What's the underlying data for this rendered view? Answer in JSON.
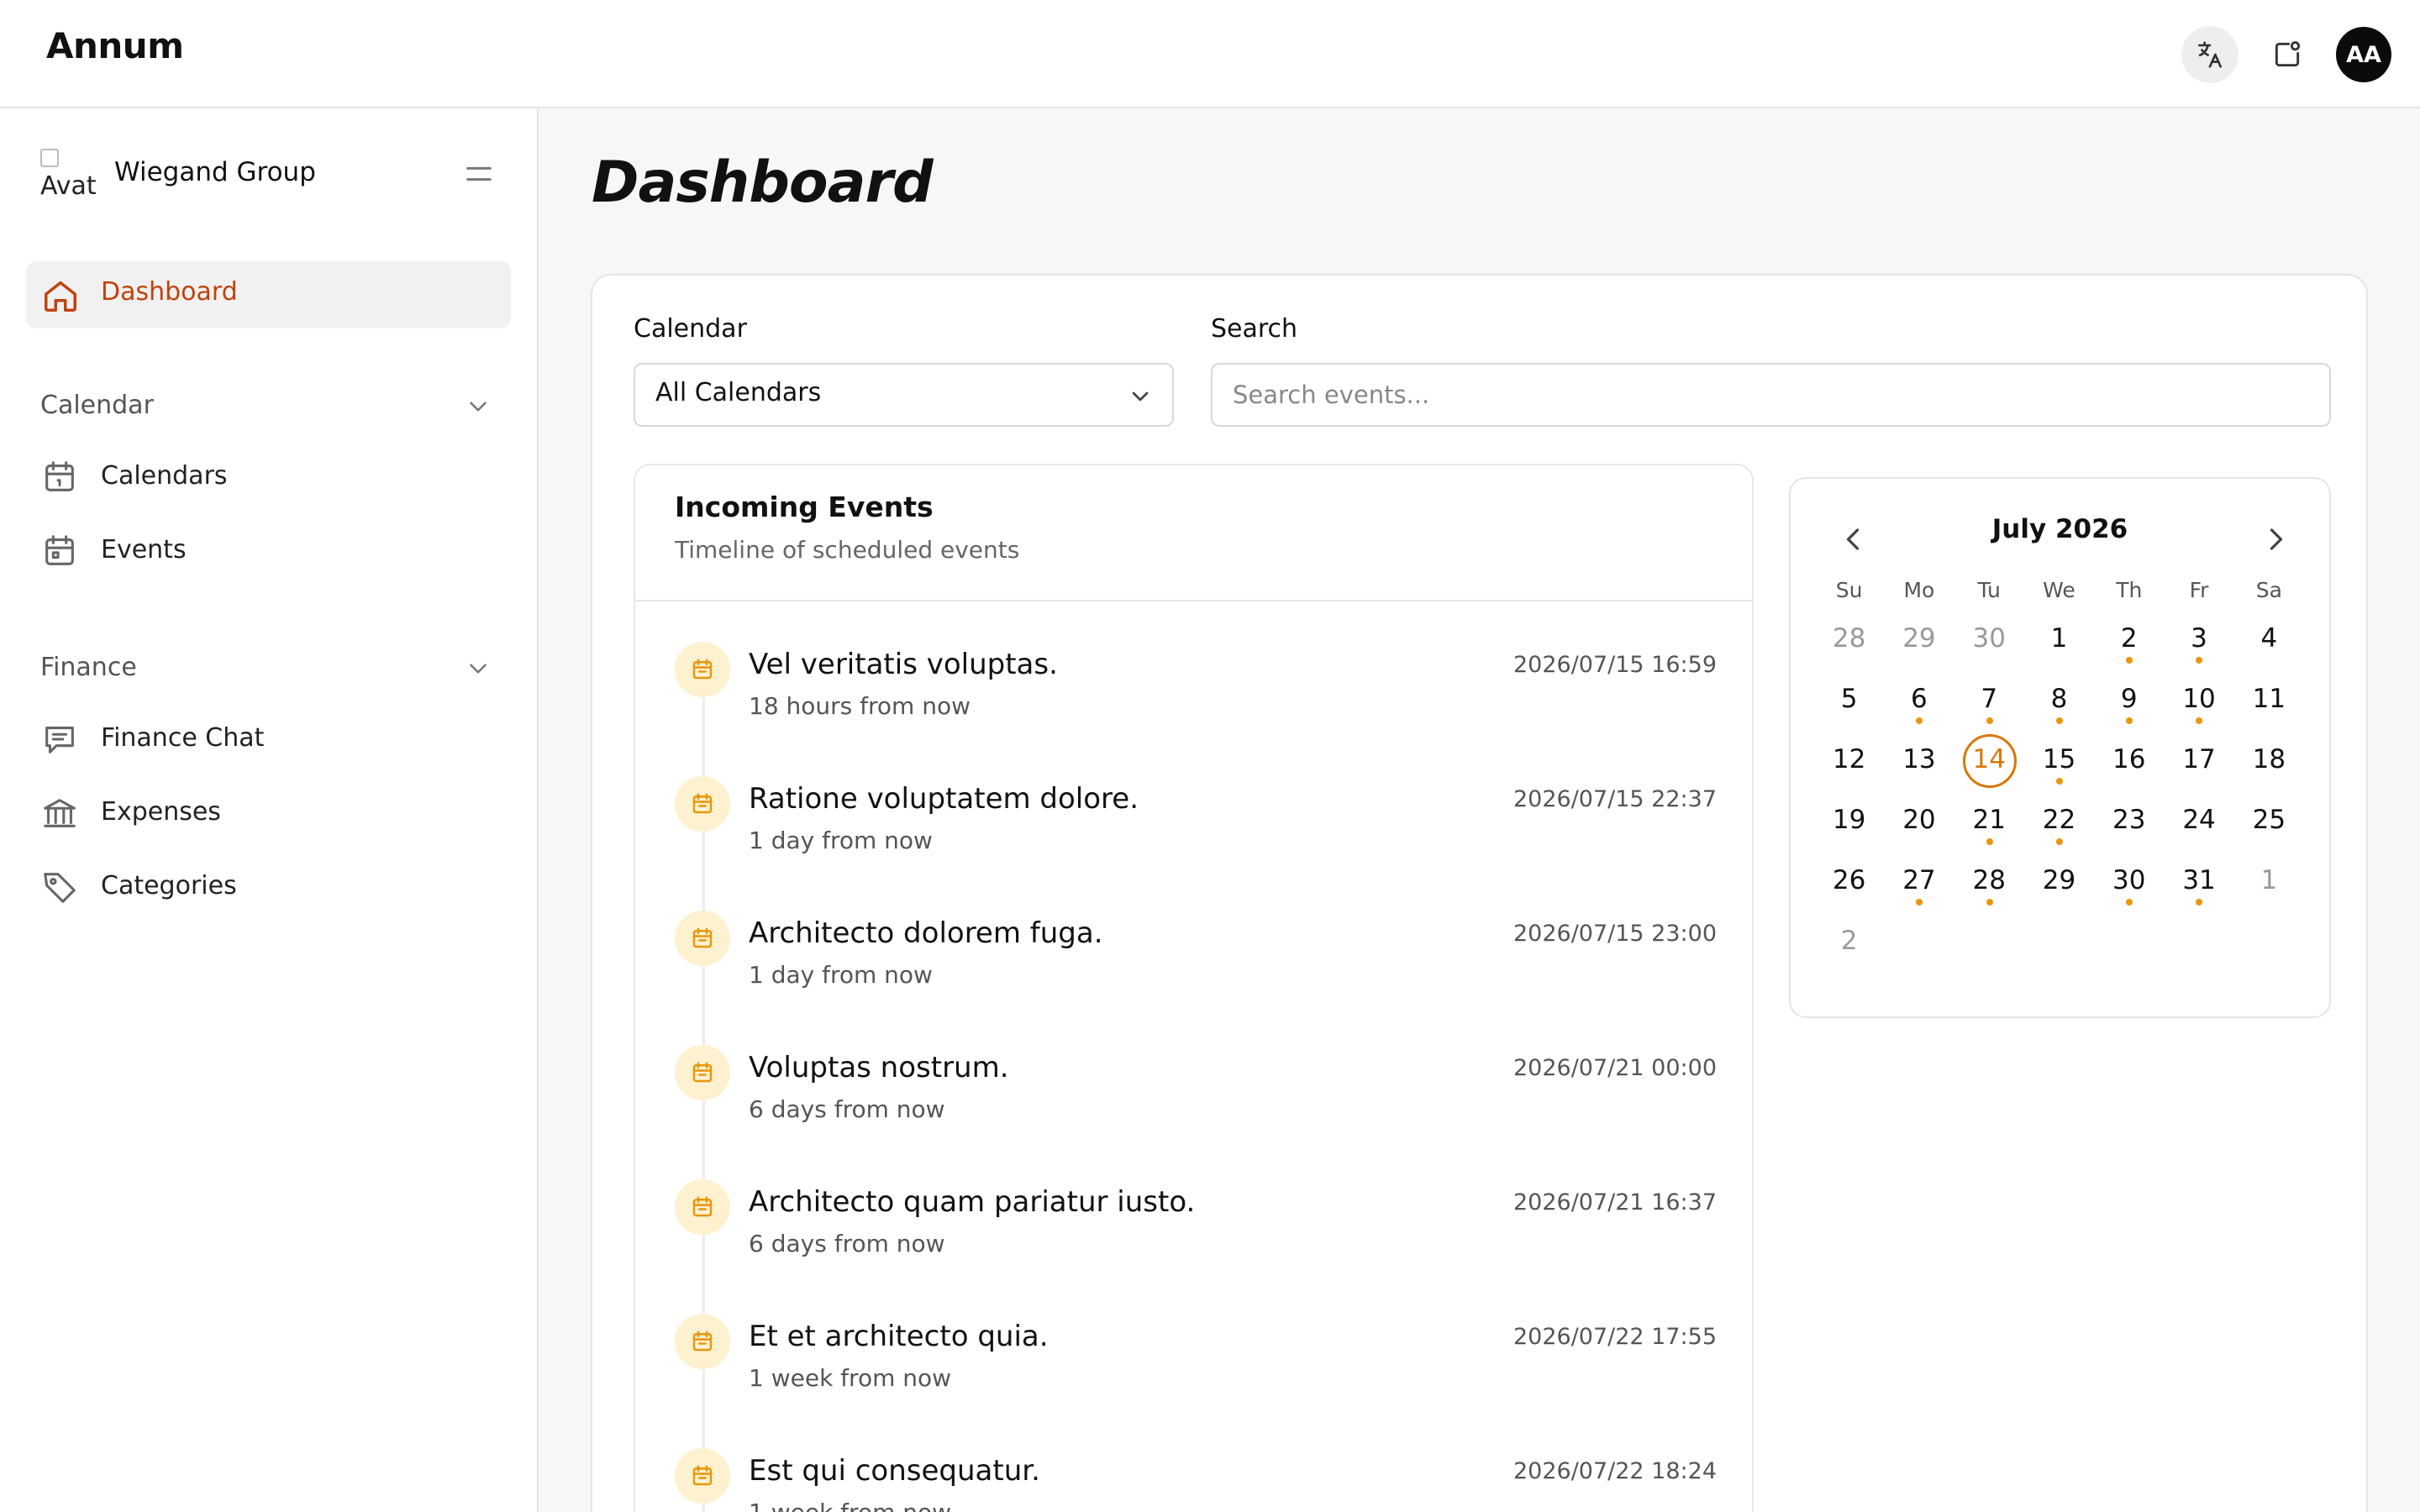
{
  "app": {
    "brand": "Annum"
  },
  "topbar": {
    "avatar_initials": "AA",
    "icons": [
      "translate-icon",
      "notification-icon"
    ]
  },
  "sidebar": {
    "org": {
      "name": "Wiegand Group",
      "avatar_alt": "Avat"
    },
    "active_item": {
      "label": "Dashboard",
      "icon": "home-icon",
      "color": "#c2410c"
    },
    "sections": [
      {
        "label": "Calendar",
        "items": [
          {
            "label": "Calendars",
            "icon": "calendar-icon"
          },
          {
            "label": "Events",
            "icon": "calendar-icon"
          }
        ]
      },
      {
        "label": "Finance",
        "items": [
          {
            "label": "Finance Chat",
            "icon": "chat-icon"
          },
          {
            "label": "Expenses",
            "icon": "bank-icon"
          },
          {
            "label": "Categories",
            "icon": "tag-icon"
          }
        ]
      }
    ]
  },
  "main": {
    "title": "Dashboard",
    "filters": {
      "calendar_label": "Calendar",
      "calendar_value": "All Calendars",
      "search_label": "Search",
      "search_placeholder": "Search events..."
    },
    "events": {
      "title": "Incoming Events",
      "subtitle": "Timeline of scheduled events",
      "items": [
        {
          "title": "Vel veritatis voluptas.",
          "relative": "18 hours from now",
          "date": "2026/07/15 16:59"
        },
        {
          "title": "Ratione voluptatem dolore.",
          "relative": "1 day from now",
          "date": "2026/07/15 22:37"
        },
        {
          "title": "Architecto dolorem fuga.",
          "relative": "1 day from now",
          "date": "2026/07/15 23:00"
        },
        {
          "title": "Voluptas nostrum.",
          "relative": "6 days from now",
          "date": "2026/07/21 00:00"
        },
        {
          "title": "Architecto quam pariatur iusto.",
          "relative": "6 days from now",
          "date": "2026/07/21 16:37"
        },
        {
          "title": "Et et architecto quia.",
          "relative": "1 week from now",
          "date": "2026/07/22 17:55"
        },
        {
          "title": "Est qui consequatur.",
          "relative": "1 week from now",
          "date": "2026/07/22 18:24"
        }
      ]
    },
    "mini_calendar": {
      "month": "July 2026",
      "weekdays": [
        "Su",
        "Mo",
        "Tu",
        "We",
        "Th",
        "Fr",
        "Sa"
      ],
      "today": 14,
      "accent": "#d97706",
      "weeks": [
        [
          {
            "d": "28",
            "m": true
          },
          {
            "d": "29",
            "m": true
          },
          {
            "d": "30",
            "m": true
          },
          {
            "d": "1"
          },
          {
            "d": "2",
            "e": true
          },
          {
            "d": "3",
            "e": true
          },
          {
            "d": "4"
          }
        ],
        [
          {
            "d": "5"
          },
          {
            "d": "6",
            "e": true
          },
          {
            "d": "7",
            "e": true
          },
          {
            "d": "8",
            "e": true
          },
          {
            "d": "9",
            "e": true
          },
          {
            "d": "10",
            "e": true
          },
          {
            "d": "11"
          }
        ],
        [
          {
            "d": "12"
          },
          {
            "d": "13"
          },
          {
            "d": "14",
            "t": true
          },
          {
            "d": "15",
            "e": true
          },
          {
            "d": "16"
          },
          {
            "d": "17"
          },
          {
            "d": "18"
          }
        ],
        [
          {
            "d": "19"
          },
          {
            "d": "20"
          },
          {
            "d": "21",
            "e": true
          },
          {
            "d": "22",
            "e": true
          },
          {
            "d": "23"
          },
          {
            "d": "24"
          },
          {
            "d": "25"
          }
        ],
        [
          {
            "d": "26"
          },
          {
            "d": "27",
            "e": true
          },
          {
            "d": "28",
            "e": true
          },
          {
            "d": "29"
          },
          {
            "d": "30",
            "e": true
          },
          {
            "d": "31",
            "e": true
          },
          {
            "d": "1",
            "m": true
          }
        ],
        [
          {
            "d": "2",
            "m": true
          }
        ]
      ]
    }
  }
}
